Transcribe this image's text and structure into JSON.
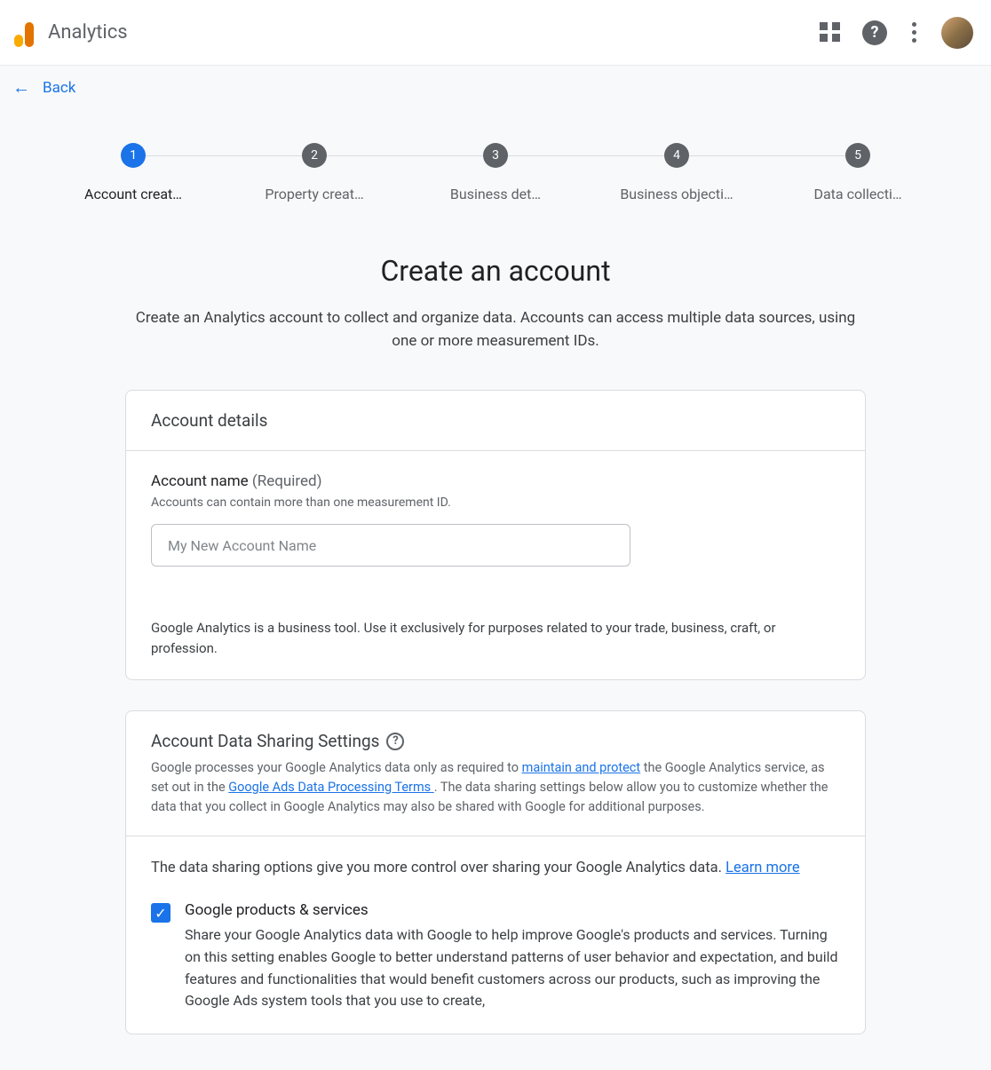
{
  "header": {
    "product": "Analytics"
  },
  "subheader": {
    "back": "Back"
  },
  "stepper": [
    {
      "num": "1",
      "label": "Account creat…",
      "active": true
    },
    {
      "num": "2",
      "label": "Property creat…",
      "active": false
    },
    {
      "num": "3",
      "label": "Business det…",
      "active": false
    },
    {
      "num": "4",
      "label": "Business objecti…",
      "active": false
    },
    {
      "num": "5",
      "label": "Data collecti…",
      "active": false
    }
  ],
  "page": {
    "title": "Create an account",
    "description": "Create an Analytics account to collect and organize data. Accounts can access multiple data sources, using one or more measurement IDs."
  },
  "account_details": {
    "card_title": "Account details",
    "name_label": "Account name",
    "name_required": "(Required)",
    "name_hint": "Accounts can contain more than one measurement ID.",
    "name_placeholder": "My New Account Name",
    "footer_note": "Google Analytics is a business tool. Use it exclusively for purposes related to your trade, business, craft, or profession."
  },
  "data_sharing": {
    "card_title": "Account Data Sharing Settings",
    "sub_pre": "Google processes your Google Analytics data only as required to ",
    "link1": "maintain and protect",
    "sub_mid1": " the Google Analytics service, as set out in the ",
    "link2": "Google Ads Data Processing Terms ",
    "sub_post": ". The data sharing settings below allow you to customize whether the data that you collect in Google Analytics may also be shared with Google for additional purposes.",
    "body_intro": "The data sharing options give you more control over sharing your Google Analytics data. ",
    "learn_more": "Learn more",
    "options": [
      {
        "title": "Google products & services",
        "desc": "Share your Google Analytics data with Google to help improve Google's products and services. Turning on this setting enables Google to better understand patterns of user behavior and expectation, and build features and functionalities that would benefit customers across our products, such as improving the Google Ads system tools that you use to create,",
        "checked": true
      }
    ]
  }
}
